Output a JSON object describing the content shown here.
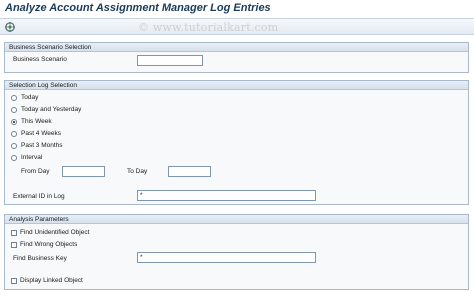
{
  "title": "Analyze Account Assignment Manager Log Entries",
  "watermark": "© www.tutorialkart.com",
  "toolbar": {
    "execute_icon": "execute-icon"
  },
  "business_scenario_selection": {
    "header": "Business Scenario Selection",
    "business_scenario_label": "Business Scenario",
    "business_scenario_value": ""
  },
  "selection_log_selection": {
    "header": "Selection Log Selection",
    "options": [
      {
        "label": "Today",
        "selected": false
      },
      {
        "label": "Today and Yesterday",
        "selected": false
      },
      {
        "label": "This Week",
        "selected": true
      },
      {
        "label": "Past 4 Weeks",
        "selected": false
      },
      {
        "label": "Past 3 Months",
        "selected": false
      },
      {
        "label": "Interval",
        "selected": false
      }
    ],
    "from_day_label": "From Day",
    "from_day_value": "",
    "to_day_label": "To Day",
    "to_day_value": "",
    "external_id_label": "External ID in Log",
    "external_id_value": "*"
  },
  "analysis_parameters": {
    "header": "Analysis Parameters",
    "find_unidentified_label": "Find Unidentified Object",
    "find_unidentified_checked": false,
    "find_wrong_label": "Find Wrong Objects",
    "find_wrong_checked": false,
    "find_business_key_label": "Find Business Key",
    "find_business_key_value": "*",
    "display_linked_label": "Display Linked Object",
    "display_linked_checked": false
  }
}
